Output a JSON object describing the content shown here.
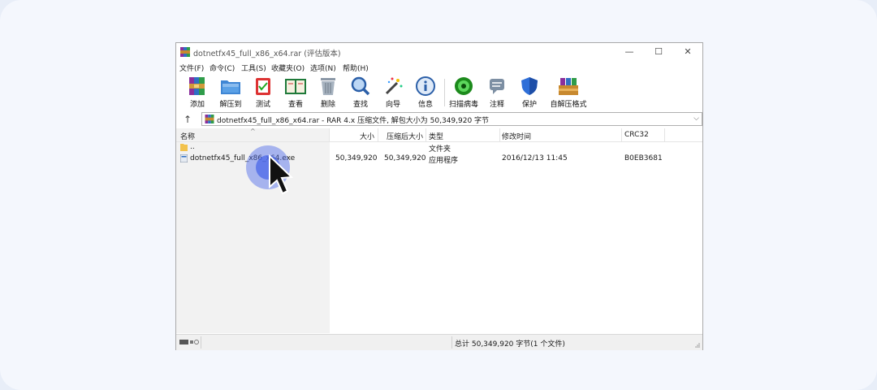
{
  "window": {
    "title": "dotnetfx45_full_x86_x64.rar (评估版本)",
    "controls": {
      "minimize": "—",
      "maximize": "☐",
      "close": "✕"
    }
  },
  "menu": [
    "文件(F)",
    "命令(C)",
    "工具(S)",
    "收藏夹(O)",
    "选项(N)",
    "帮助(H)"
  ],
  "toolbar": [
    {
      "label": "添加",
      "icon": "add-archive-icon"
    },
    {
      "label": "解压到",
      "icon": "extract-folder-icon"
    },
    {
      "label": "测试",
      "icon": "test-clipboard-icon"
    },
    {
      "label": "查看",
      "icon": "view-book-icon"
    },
    {
      "label": "删除",
      "icon": "trash-icon"
    },
    {
      "label": "查找",
      "icon": "magnifier-icon"
    },
    {
      "label": "向导",
      "icon": "wizard-wand-icon"
    },
    {
      "label": "信息",
      "icon": "info-icon"
    },
    {
      "label": "扫描病毒",
      "icon": "virus-scan-icon"
    },
    {
      "label": "注释",
      "icon": "comment-icon"
    },
    {
      "label": "保护",
      "icon": "shield-icon"
    },
    {
      "label": "自解压格式",
      "icon": "sfx-boxes-icon"
    }
  ],
  "address": {
    "up": "↑",
    "path": "dotnetfx45_full_x86_x64.rar - RAR 4.x 压缩文件, 解包大小为 50,349,920 字节",
    "dropdown": "⌵"
  },
  "columns": {
    "name": "名称",
    "size": "大小",
    "packed": "压缩后大小",
    "type": "类型",
    "modified": "修改时间",
    "crc": "CRC32",
    "sort_indicator": "^"
  },
  "rows": [
    {
      "name": "..",
      "size": "",
      "packed": "",
      "type": "文件夹",
      "modified": "",
      "crc": ""
    },
    {
      "name": "dotnetfx45_full_x86_x64.exe",
      "size": "50,349,920",
      "packed": "50,349,920",
      "type": "应用程序",
      "modified": "2016/12/13 11:45",
      "crc": "B0EB3681"
    }
  ],
  "status": {
    "summary": "总计 50,349,920 字节(1 个文件)"
  },
  "colors": {
    "highlight": "#4a67e8",
    "background": "#f4f7fd"
  }
}
